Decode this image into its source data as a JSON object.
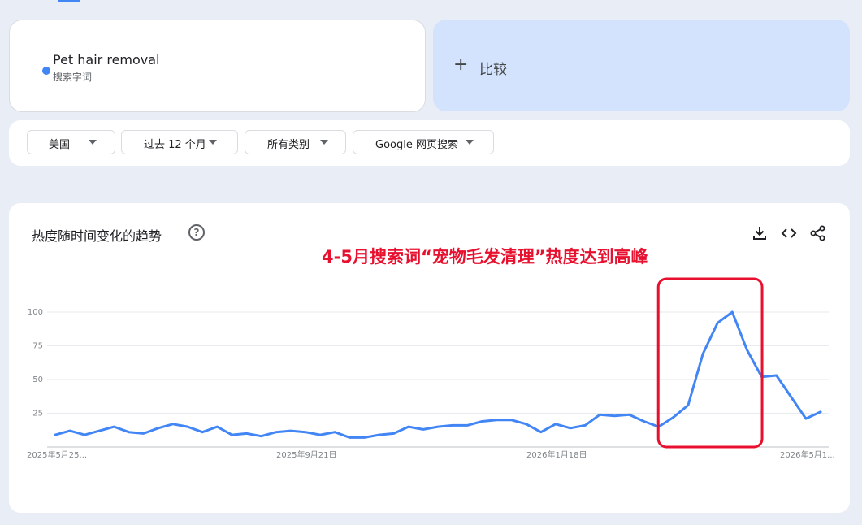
{
  "term": {
    "name": "Pet hair removal",
    "type": "搜索字词",
    "color": "#4285f4"
  },
  "compare": {
    "label": "比较"
  },
  "filters": [
    {
      "label": "美国"
    },
    {
      "label": "过去 12 个月"
    },
    {
      "label": "所有类别"
    },
    {
      "label": "Google 网页搜索"
    }
  ],
  "chart": {
    "title": "热度随时间变化的趋势",
    "help_symbol": "?",
    "annotation": "4-5月搜索词“宠物毛发清理”热度达到高峰",
    "annotation_color": "#e8102f",
    "actions": [
      "download-icon",
      "embed-code-icon",
      "share-icon"
    ]
  },
  "chart_data": {
    "type": "line",
    "x_tick_labels": [
      "2025年5月25...",
      "2025年9月21日",
      "2026年1月18日",
      "2026年5月1..."
    ],
    "y_ticks": [
      100,
      75,
      50,
      25
    ],
    "ylim": [
      0,
      100
    ],
    "grid": true,
    "series": [
      {
        "color": "#4285f4",
        "values": [
          9,
          12,
          9,
          12,
          15,
          11,
          10,
          14,
          17,
          15,
          11,
          15,
          9,
          10,
          8,
          11,
          12,
          11,
          9,
          11,
          7,
          7,
          9,
          10,
          15,
          13,
          15,
          16,
          16,
          19,
          20,
          20,
          17,
          11,
          17,
          14,
          16,
          24,
          23,
          24,
          19,
          15,
          22,
          31,
          69,
          92,
          100,
          72,
          52,
          53,
          37,
          21,
          26
        ]
      }
    ],
    "highlight_range": [
      41,
      48
    ],
    "highlight_color": "#e8102f"
  }
}
